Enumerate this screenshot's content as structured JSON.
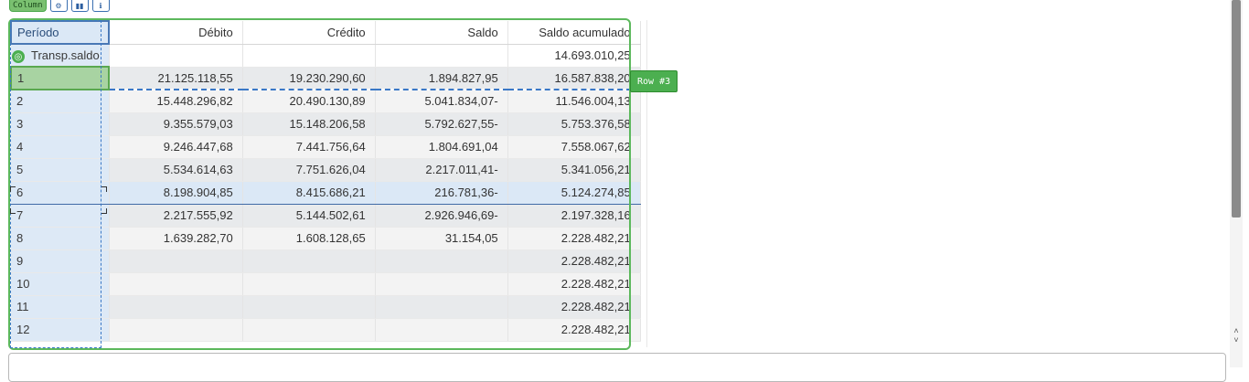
{
  "toolbar": {
    "column_label": "Column",
    "buttons": [
      "settings-icon",
      "chart-icon",
      "info-icon"
    ]
  },
  "table": {
    "headers": [
      "Período",
      "Débito",
      "Crédito",
      "Saldo",
      "Saldo acumulado"
    ],
    "rows": [
      {
        "periodo": "Transp.saldo",
        "debito": "",
        "credito": "",
        "saldo": "",
        "acumulado": "14.693.010,25"
      },
      {
        "periodo": "1",
        "debito": "21.125.118,55",
        "credito": "19.230.290,60",
        "saldo": "1.894.827,95",
        "acumulado": "16.587.838,20"
      },
      {
        "periodo": "2",
        "debito": "15.448.296,82",
        "credito": "20.490.130,89",
        "saldo": "5.041.834,07-",
        "acumulado": "11.546.004,13"
      },
      {
        "periodo": "3",
        "debito": "9.355.579,03",
        "credito": "15.148.206,58",
        "saldo": "5.792.627,55-",
        "acumulado": "5.753.376,58"
      },
      {
        "periodo": "4",
        "debito": "9.246.447,68",
        "credito": "7.441.756,64",
        "saldo": "1.804.691,04",
        "acumulado": "7.558.067,62"
      },
      {
        "periodo": "5",
        "debito": "5.534.614,63",
        "credito": "7.751.626,04",
        "saldo": "2.217.011,41-",
        "acumulado": "5.341.056,21"
      },
      {
        "periodo": "6",
        "debito": "8.198.904,85",
        "credito": "8.415.686,21",
        "saldo": "216.781,36-",
        "acumulado": "5.124.274,85"
      },
      {
        "periodo": "7",
        "debito": "2.217.555,92",
        "credito": "5.144.502,61",
        "saldo": "2.926.946,69-",
        "acumulado": "2.197.328,16"
      },
      {
        "periodo": "8",
        "debito": "1.639.282,70",
        "credito": "1.608.128,65",
        "saldo": "31.154,05",
        "acumulado": "2.228.482,21"
      },
      {
        "periodo": "9",
        "debito": "",
        "credito": "",
        "saldo": "",
        "acumulado": "2.228.482,21"
      },
      {
        "periodo": "10",
        "debito": "",
        "credito": "",
        "saldo": "",
        "acumulado": "2.228.482,21"
      },
      {
        "periodo": "11",
        "debito": "",
        "credito": "",
        "saldo": "",
        "acumulado": "2.228.482,21"
      },
      {
        "periodo": "12",
        "debito": "",
        "credito": "",
        "saldo": "",
        "acumulado": "2.228.482,21"
      }
    ]
  },
  "overlay": {
    "row_tag": "Row #3",
    "target_icon": "target-icon"
  },
  "colors": {
    "accent_green": "#5cb85c",
    "accent_blue": "#3a78c6",
    "selected_row": "#dbe8f6"
  }
}
